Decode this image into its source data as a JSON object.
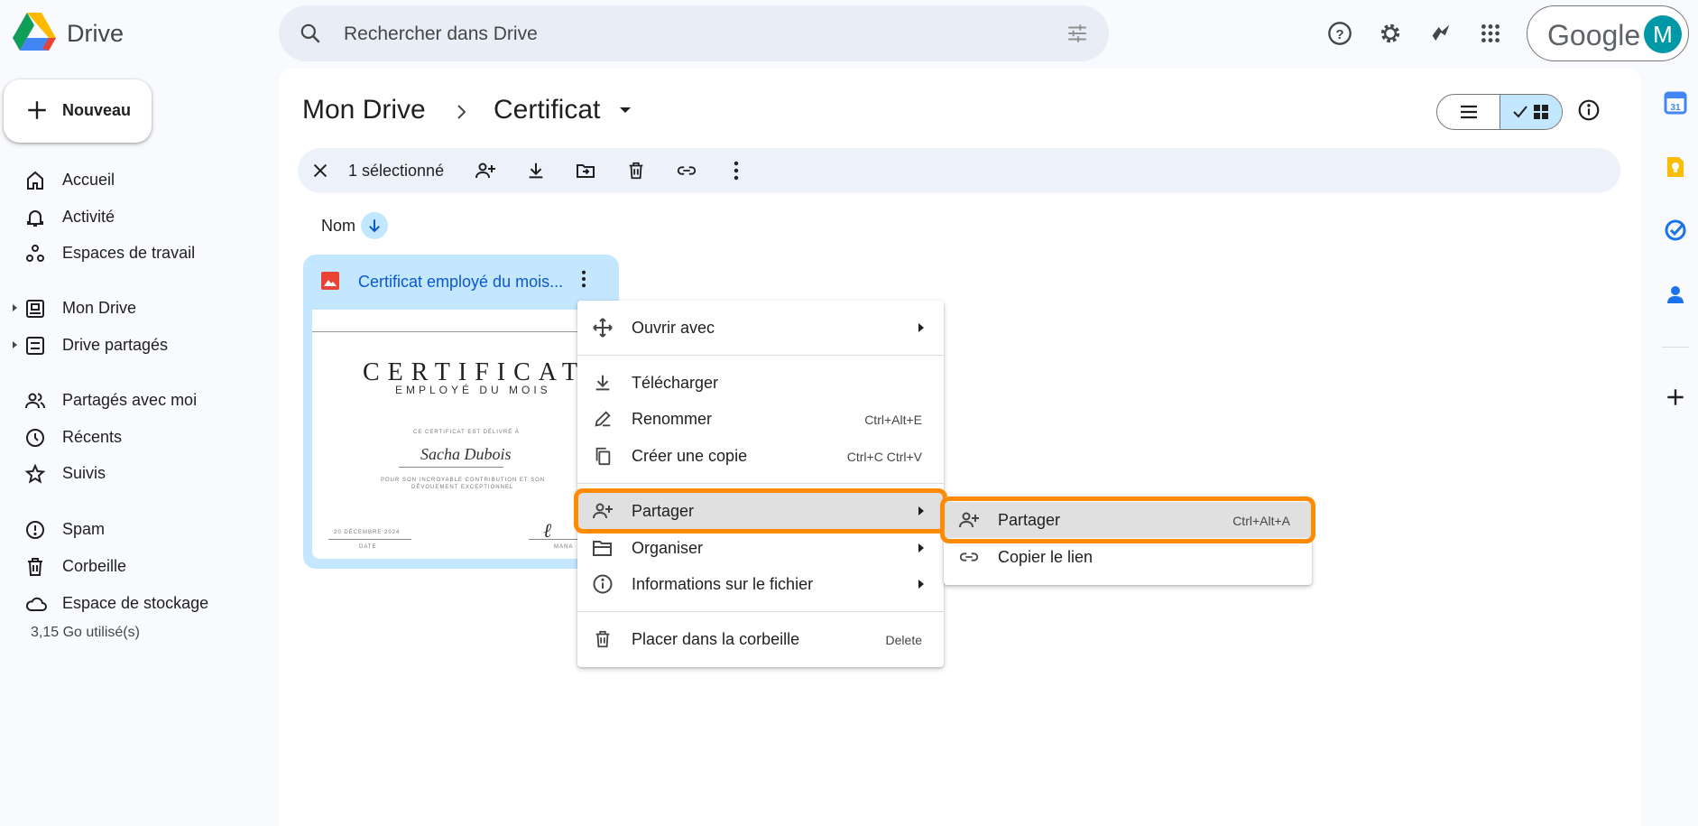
{
  "header": {
    "app_name": "Drive",
    "search_placeholder": "Rechercher dans Drive",
    "account_brand": "Google",
    "avatar_initial": "M",
    "icons": [
      "help-icon",
      "settings-icon",
      "gemini-icon",
      "apps-grid-icon",
      "search-options-icon"
    ]
  },
  "new_button": {
    "label": "Nouveau"
  },
  "sidebar": {
    "items": [
      {
        "label": "Accueil",
        "icon": "home-icon"
      },
      {
        "label": "Activité",
        "icon": "bell-icon"
      },
      {
        "label": "Espaces de travail",
        "icon": "workspaces-icon"
      },
      {
        "label": "Mon Drive",
        "icon": "my-drive-icon"
      },
      {
        "label": "Drive partagés",
        "icon": "shared-drives-icon"
      },
      {
        "label": "Partagés avec moi",
        "icon": "people-icon"
      },
      {
        "label": "Récents",
        "icon": "clock-icon"
      },
      {
        "label": "Suivis",
        "icon": "star-icon"
      },
      {
        "label": "Spam",
        "icon": "spam-icon"
      },
      {
        "label": "Corbeille",
        "icon": "trash-icon"
      },
      {
        "label": "Espace de stockage",
        "icon": "cloud-icon"
      }
    ],
    "storage_used": "3,15 Go utilisé(s)"
  },
  "breadcrumb": {
    "root": "Mon Drive",
    "current": "Certificat"
  },
  "selection_bar": {
    "count_label": "1 sélectionné"
  },
  "sort": {
    "label": "Nom"
  },
  "file": {
    "name": "Certificat employé du mois...",
    "thumbnail": {
      "title": "CERTIFICAT",
      "subtitle": "EMPLOYÉ DU MOIS",
      "awarded_to": "CE CERTIFICAT EST DÉLIVRÉ À",
      "recipient": "Sacha Dubois",
      "reason_line1": "POUR SON INCROYABLE CONTRIBUTION ET SON",
      "reason_line2": "DÉVOUEMENT EXCEPTIONNEL",
      "date": "20 DÉCEMBRE 2024",
      "date_label": "DATE",
      "manager_label": "MANA"
    }
  },
  "context_menu": {
    "items": [
      {
        "label": "Ouvrir avec",
        "shortcut": "",
        "icon": "open-with-icon"
      },
      {
        "label": "Télécharger",
        "shortcut": "",
        "icon": "download-icon"
      },
      {
        "label": "Renommer",
        "shortcut": "Ctrl+Alt+E",
        "icon": "rename-icon"
      },
      {
        "label": "Créer une copie",
        "shortcut": "Ctrl+C Ctrl+V",
        "icon": "copy-icon"
      },
      {
        "label": "Partager",
        "shortcut": "",
        "icon": "share-icon"
      },
      {
        "label": "Organiser",
        "shortcut": "",
        "icon": "folder-icon"
      },
      {
        "label": "Informations sur le fichier",
        "shortcut": "",
        "icon": "info-icon"
      },
      {
        "label": "Placer dans la corbeille",
        "shortcut": "Delete",
        "icon": "trash-icon"
      }
    ]
  },
  "share_submenu": {
    "items": [
      {
        "label": "Partager",
        "shortcut": "Ctrl+Alt+A",
        "icon": "share-icon"
      },
      {
        "label": "Copier le lien",
        "shortcut": "",
        "icon": "link-icon"
      }
    ]
  },
  "colors": {
    "accent": "#0b57d0",
    "selected_bg": "#c2e7ff",
    "highlight_ring": "#ff8c00",
    "file_icon": "#ea4335"
  }
}
